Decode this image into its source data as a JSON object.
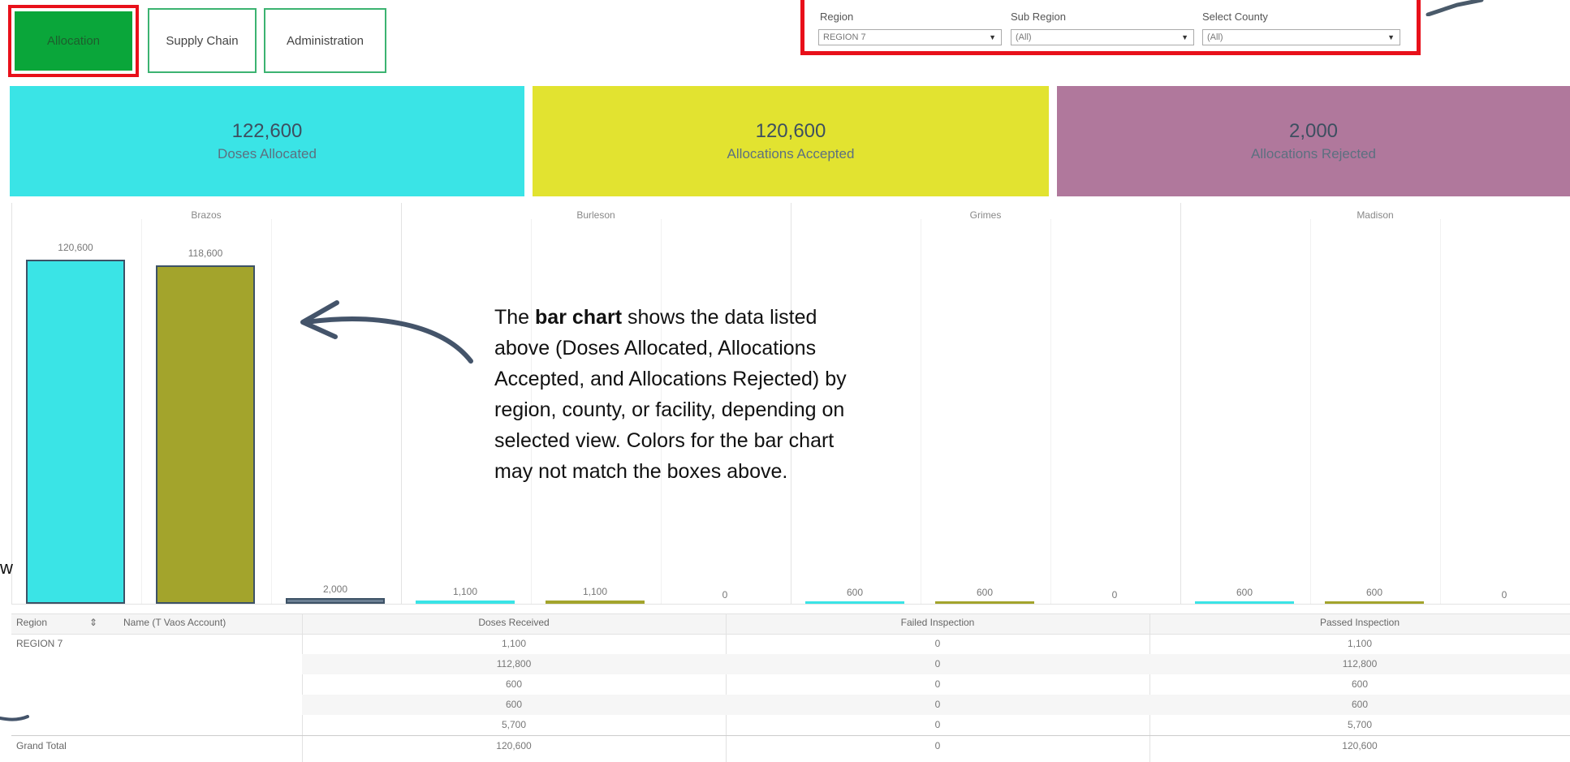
{
  "tabs": [
    {
      "label": "Allocation",
      "active": true
    },
    {
      "label": "Supply Chain",
      "active": false
    },
    {
      "label": "Administration",
      "active": false
    }
  ],
  "filters": [
    {
      "label": "Region",
      "value": "REGION 7"
    },
    {
      "label": "Sub Region",
      "value": "(All)"
    },
    {
      "label": "Select County",
      "value": "(All)"
    }
  ],
  "kpis": [
    {
      "value": "122,600",
      "label": "Doses Allocated",
      "color": "#3ae4e6"
    },
    {
      "value": "120,600",
      "label": "Allocations Accepted",
      "color": "#e2e330"
    },
    {
      "value": "2,000",
      "label": "Allocations Rejected",
      "color": "#b0789c"
    }
  ],
  "chart_data": {
    "type": "bar",
    "counties": [
      "Brazos",
      "Burleson",
      "Grimes",
      "Madison"
    ],
    "series": [
      {
        "color": "#3ae4e6"
      },
      {
        "color": "#a3a42c"
      },
      {
        "color": "#6b7f93"
      }
    ],
    "values": [
      [
        120600,
        118600,
        2000
      ],
      [
        1100,
        1100,
        0
      ],
      [
        600,
        600,
        0
      ],
      [
        600,
        600,
        0
      ]
    ],
    "value_labels": [
      [
        "120,600",
        "118,600",
        "2,000"
      ],
      [
        "1,100",
        "1,100",
        "0"
      ],
      [
        "600",
        "600",
        "0"
      ],
      [
        "600",
        "600",
        "0"
      ]
    ],
    "ymax": 120600
  },
  "annotation": {
    "bold": "bar chart",
    "prefix": "The ",
    "rest": " shows the data listed above (Doses Allocated, Allocations Accepted, and Allocations Rejected) by region, county, or facility, depending on selected view. Colors for the bar chart may not match the boxes above."
  },
  "left_edge_text": "w",
  "table": {
    "headers": [
      "Region",
      "Name (T Vaos Account)",
      "Doses Received",
      "Failed Inspection",
      "Passed Inspection"
    ],
    "sort_glyph": "⇕",
    "region": "REGION 7",
    "rows": [
      [
        "1,100",
        "0",
        "1,100"
      ],
      [
        "112,800",
        "0",
        "112,800"
      ],
      [
        "600",
        "0",
        "600"
      ],
      [
        "600",
        "0",
        "600"
      ],
      [
        "5,700",
        "0",
        "5,700"
      ]
    ],
    "total_label": "Grand Total",
    "total": [
      "120,600",
      "0",
      "120,600"
    ]
  }
}
